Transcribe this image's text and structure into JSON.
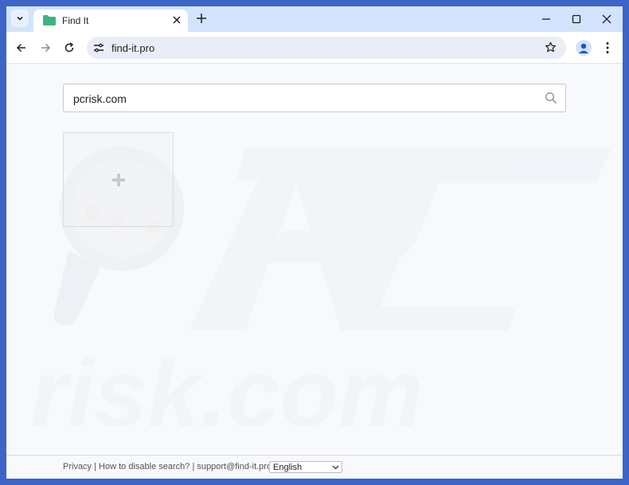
{
  "browser": {
    "tab": {
      "title": "Find It"
    },
    "address_bar": {
      "url": "find-it.pro"
    }
  },
  "page": {
    "search": {
      "value": "pcrisk.com"
    },
    "footer": {
      "privacy": "Privacy",
      "separator": " | ",
      "disable": "How to disable search?",
      "support": "support@find-it.pro",
      "language": "English"
    }
  },
  "icons": {
    "tab_search": "chevron-down-icon",
    "favicon": "folder-icon",
    "close": "close-icon",
    "new_tab": "plus-icon",
    "back": "arrow-left-icon",
    "forward": "arrow-right-icon",
    "reload": "reload-icon",
    "site_info": "tune-icon",
    "bookmark": "star-icon",
    "profile": "person-icon",
    "menu": "more-vert-icon",
    "search": "search-icon"
  },
  "colors": {
    "frame": "#3d64c8",
    "tabstrip": "#d3e3fd",
    "favicon": "#3fb37f",
    "omnibox": "#e9eef6"
  }
}
